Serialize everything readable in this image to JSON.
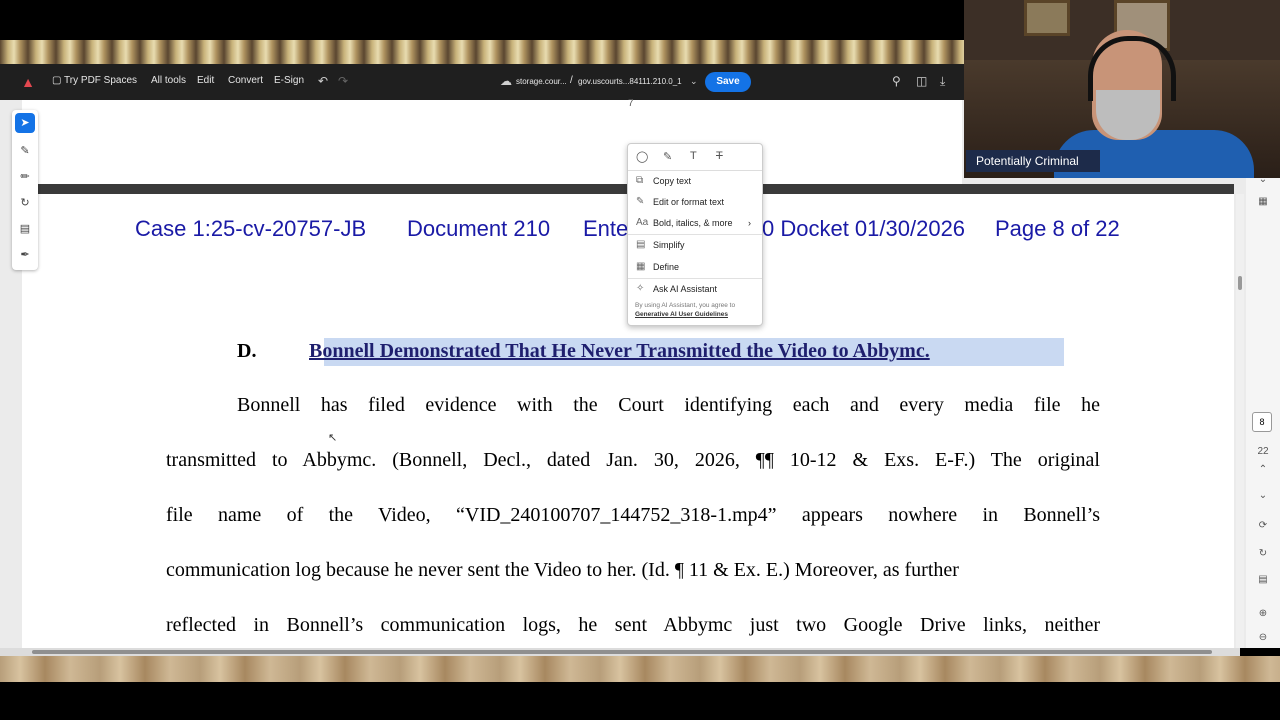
{
  "toolbar": {
    "logo": "acrobat-logo",
    "try_spaces": "Try PDF Spaces",
    "all_tools": "All tools",
    "edit": "Edit",
    "convert": "Convert",
    "esign": "E-Sign",
    "breadcrumb_storage": "storage.cour...",
    "breadcrumb_sep": "/",
    "breadcrumb_file": "gov.uscourts...84111.210.0_1",
    "save_label": "Save"
  },
  "page_header": {
    "case": "Case 1:25-cv-20757-JB",
    "document": "Document 210",
    "entered_prefix": "Ente",
    "entered_suffix": "0 Docket 01/30/2026",
    "page": "Page 8 of 22"
  },
  "section": {
    "letter": "D.",
    "title": "Bonnell Demonstrated That He Never Transmitted the Video to Abbymc."
  },
  "body_lines": [
    "Bonnell has filed evidence with the Court identifying each and every media file he",
    "transmitted to Abbymc. (Bonnell, Decl., dated Jan. 30, 2026, ¶¶ 10-12 & Exs. E-F.) The original",
    "file name of the Video, “VID_240100707_144752_318-1.mp4” appears nowhere in Bonnell’s",
    "communication log because he never sent the Video to her.",
    "reflected in Bonnell’s communication logs, he sent Abbymc just two Google Drive links, neither"
  ],
  "body_line4_cite": "(Id. ¶ 11 & Ex. E.) Moreover, as further",
  "context_menu": {
    "items": [
      {
        "label": "Copy text",
        "icon": "copy-icon"
      },
      {
        "label": "Edit or format text",
        "icon": "edit-text-icon"
      },
      {
        "label": "Bold, italics, & more",
        "icon": "font-icon"
      },
      {
        "label": "Simplify",
        "icon": "simplify-icon"
      },
      {
        "label": "Define",
        "icon": "define-icon"
      },
      {
        "label": "Ask AI Assistant",
        "icon": "ai-assistant-icon"
      }
    ],
    "note": "By using AI Assistant, you agree to",
    "note_link": "Generative AI User Guidelines"
  },
  "webcam": {
    "caption": "Potentially Criminal"
  },
  "right_rail": {
    "current_page": "8",
    "total_pages": "22"
  },
  "colors": {
    "accent": "#1473e6",
    "header_blue": "#1a1aa6",
    "highlight": "#c9d9f2"
  }
}
